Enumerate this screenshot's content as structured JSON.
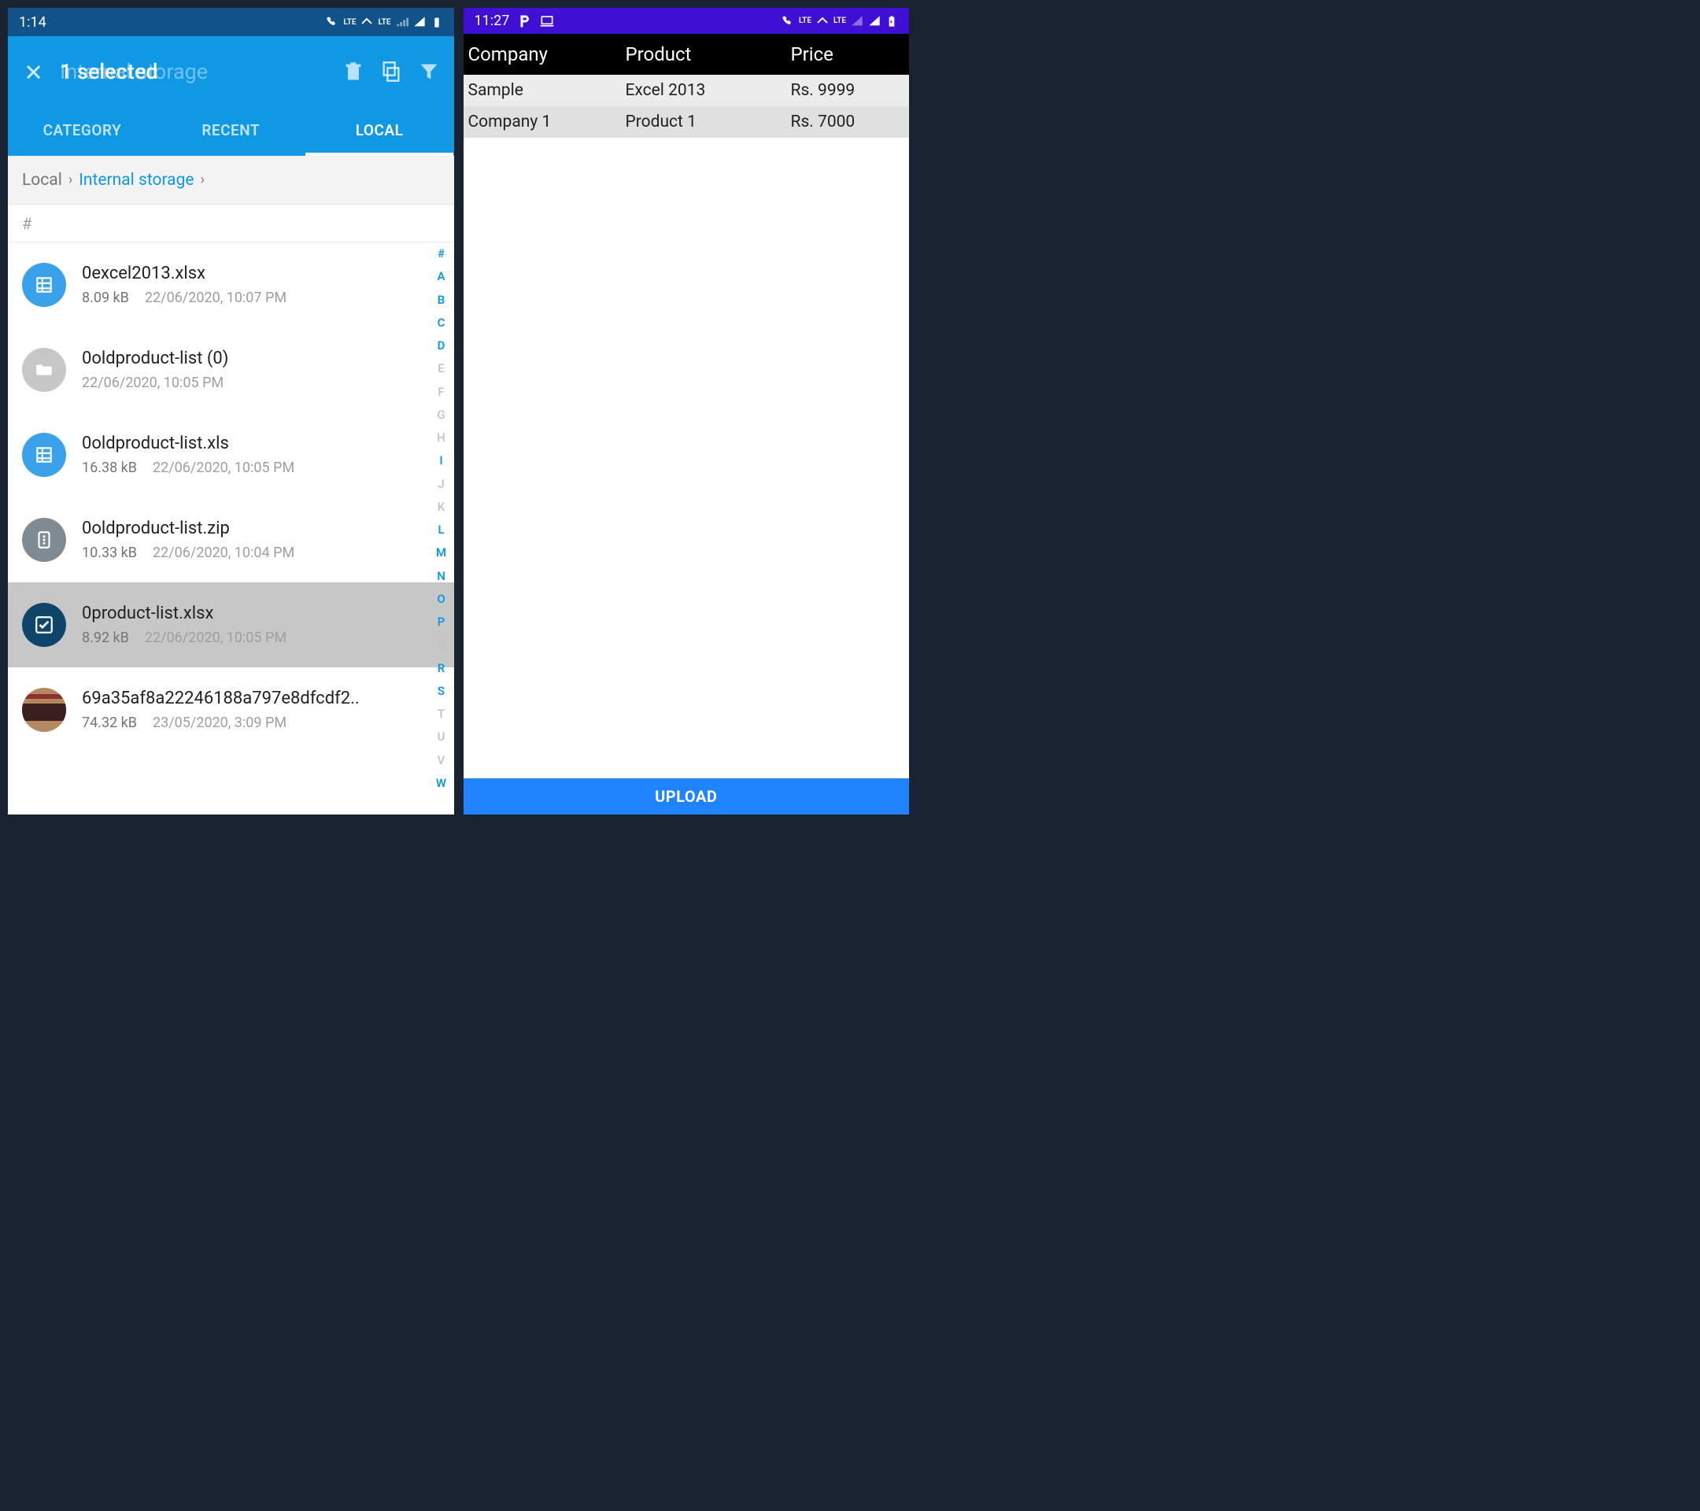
{
  "left": {
    "status": {
      "time": "1:14"
    },
    "toolbar": {
      "title_bg": "Internal storage",
      "title_fg": "1 selected"
    },
    "tabs": [
      {
        "label": "CATEGORY"
      },
      {
        "label": "RECENT"
      },
      {
        "label": "LOCAL"
      }
    ],
    "breadcrumb": {
      "root": "Local",
      "current": "Internal storage"
    },
    "section": "#",
    "files": [
      {
        "name": "0excel2013.xlsx",
        "size": "8.09 kB",
        "date": "22/06/2020, 10:07 PM",
        "icon": "sheet",
        "selected": false
      },
      {
        "name": "0oldproduct-list (0)",
        "size": "",
        "date": "22/06/2020, 10:05 PM",
        "icon": "folder",
        "selected": false
      },
      {
        "name": "0oldproduct-list.xls",
        "size": "16.38 kB",
        "date": "22/06/2020, 10:05 PM",
        "icon": "sheet",
        "selected": false
      },
      {
        "name": "0oldproduct-list.zip",
        "size": "10.33 kB",
        "date": "22/06/2020, 10:04 PM",
        "icon": "zip",
        "selected": false
      },
      {
        "name": "0product-list.xlsx",
        "size": "8.92 kB",
        "date": "22/06/2020, 10:05 PM",
        "icon": "check",
        "selected": true
      },
      {
        "name": "69a35af8a22246188a797e8dfcdf2..",
        "size": "74.32 kB",
        "date": "23/05/2020, 3:09 PM",
        "icon": "image",
        "selected": false
      }
    ],
    "az": [
      "#",
      "A",
      "B",
      "C",
      "D",
      "E",
      "F",
      "G",
      "H",
      "I",
      "J",
      "K",
      "L",
      "M",
      "N",
      "O",
      "P",
      "Q",
      "R",
      "S",
      "T",
      "U",
      "V",
      "W"
    ],
    "az_active": [
      "#",
      "A",
      "B",
      "C",
      "D",
      "I",
      "L",
      "M",
      "N",
      "O",
      "P",
      "R",
      "S",
      "W"
    ]
  },
  "right": {
    "status": {
      "time": "11:27"
    },
    "columns": [
      "Company",
      "Product",
      "Price"
    ],
    "rows": [
      {
        "company": "Sample",
        "product": "Excel 2013",
        "price": "Rs. 9999"
      },
      {
        "company": "Company 1",
        "product": "Product 1",
        "price": "Rs. 7000"
      }
    ],
    "upload": "UPLOAD"
  }
}
